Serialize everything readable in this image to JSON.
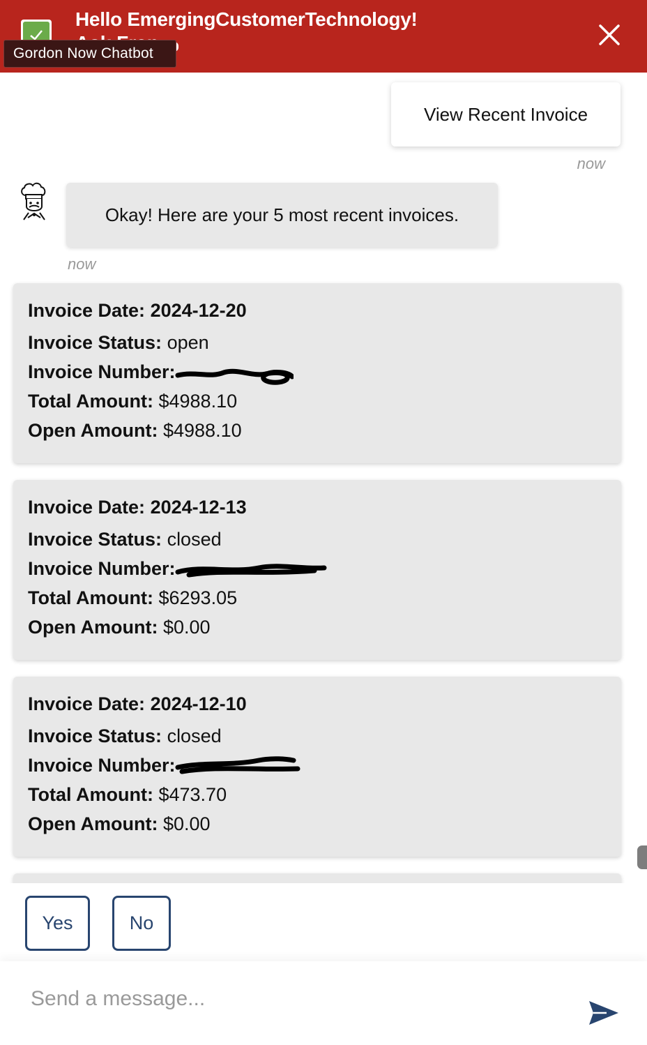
{
  "header": {
    "title": "Hello EmergingCustomerTechnology!",
    "subtitle": "Ask Fran",
    "tooltip": "Gordon Now Chatbot"
  },
  "messages": {
    "user_text": "View Recent Invoice",
    "user_timestamp": "now",
    "bot_text": "Okay! Here are your 5 most recent invoices.",
    "bot_timestamp": "now"
  },
  "labels": {
    "date": "Invoice Date:",
    "status": "Invoice Status:",
    "number": "Invoice Number:",
    "total": "Total Amount:",
    "open": "Open Amount:"
  },
  "invoices": [
    {
      "date": "2024-12-20",
      "status": "open",
      "total": "$4988.10",
      "open": "$4988.10"
    },
    {
      "date": "2024-12-13",
      "status": "closed",
      "total": "$6293.05",
      "open": "$0.00"
    },
    {
      "date": "2024-12-10",
      "status": "closed",
      "total": "$473.70",
      "open": "$0.00"
    }
  ],
  "quick_replies": {
    "yes": "Yes",
    "no": "No"
  },
  "input": {
    "placeholder": "Send a message..."
  },
  "colors": {
    "header_bg": "#b8251d",
    "accent": "#28456f",
    "bubble_bg": "#e8e8e8"
  },
  "icons": {
    "logo": "chat-logo-icon",
    "close": "close-icon",
    "avatar": "chef-bot-avatar-icon",
    "send": "send-icon"
  }
}
